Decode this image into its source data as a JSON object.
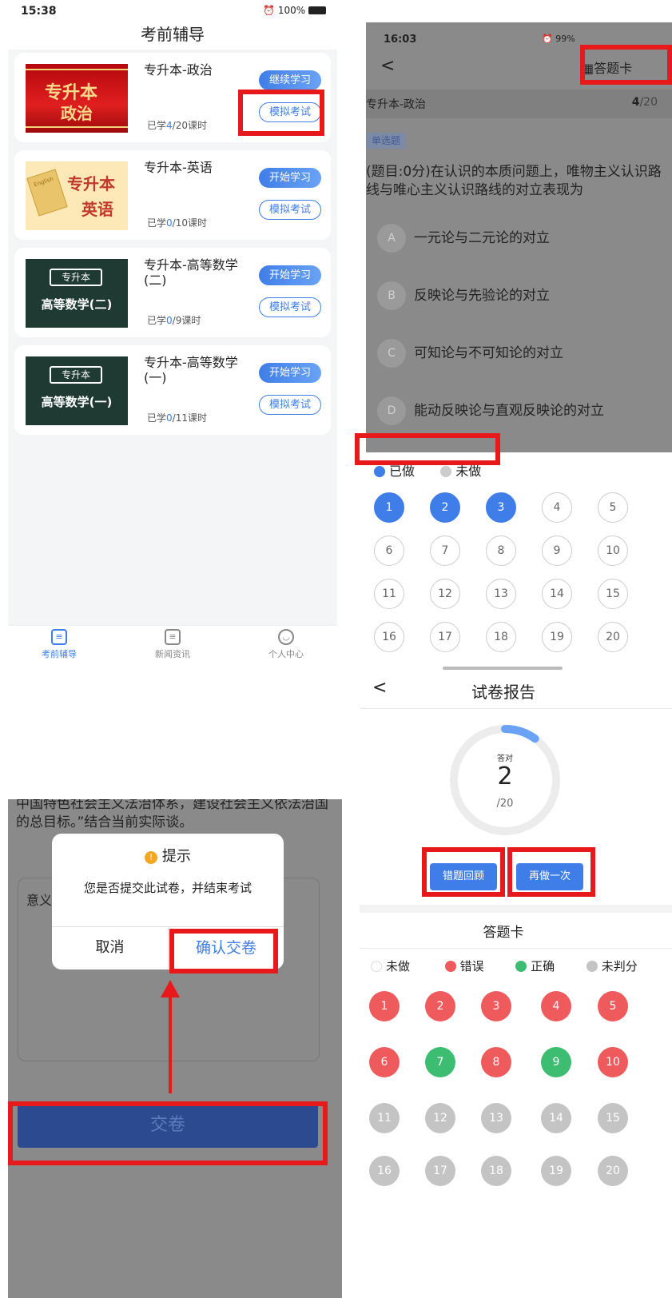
{
  "panel1": {
    "status_time": "15:38",
    "status_right": "100%",
    "header_title": "考前辅导",
    "courses": [
      {
        "thumb_line1": "专升本",
        "thumb_line2": "政治",
        "title": "专升本-政治",
        "prog_pre": "已学",
        "prog_num": "4",
        "prog_post": "/20课时",
        "study_label": "继续学习",
        "mock_label": "模拟考试"
      },
      {
        "thumb_line1": "专升本",
        "thumb_line2": "英语",
        "thumb_tag": "English",
        "title": "专升本-英语",
        "prog_pre": "已学",
        "prog_num": "0",
        "prog_post": "/10课时",
        "study_label": "开始学习",
        "mock_label": "模拟考试"
      },
      {
        "thumb_line1": "专升本",
        "thumb_line2": "高等数学(二)",
        "title": "专升本-高等数学(二)",
        "prog_pre": "已学",
        "prog_num": "0",
        "prog_post": "/9课时",
        "study_label": "开始学习",
        "mock_label": "模拟考试"
      },
      {
        "thumb_line1": "专升本",
        "thumb_line2": "高等数学(一)",
        "title": "专升本-高等数学(一)",
        "prog_pre": "已学",
        "prog_num": "0",
        "prog_post": "/11课时",
        "study_label": "开始学习",
        "mock_label": "模拟考试"
      }
    ],
    "tabs": [
      "考前辅导",
      "新闻资讯",
      "个人中心"
    ]
  },
  "panel2": {
    "status_time": "16:03",
    "status_right": "99%",
    "answer_card_label": "答题卡",
    "subject": "专升本-政治",
    "page_current": "4",
    "page_total": "/20",
    "qtype": "单选题",
    "question": "(题目:0分)在认识的本质问题上，唯物主义认识路线与唯心主义认识路线的对立表现为",
    "options": [
      {
        "letter": "A",
        "text": "一元论与二元论的对立"
      },
      {
        "letter": "B",
        "text": "反映论与先验论的对立"
      },
      {
        "letter": "C",
        "text": "可知论与不可知论的对立"
      },
      {
        "letter": "D",
        "text": "能动反映论与直观反映论的对立"
      }
    ],
    "legend_done": "已做",
    "legend_undone": "未做",
    "numbers": [
      "1",
      "2",
      "3",
      "4",
      "5",
      "6",
      "7",
      "8",
      "9",
      "10",
      "11",
      "12",
      "13",
      "14",
      "15",
      "16",
      "17",
      "18",
      "19",
      "20"
    ],
    "done_count": 3
  },
  "panel3": {
    "essay_text": "全会对全面推进依法治国做出战略部署，提出了建设中国特色社会主义法治体系，建设社会主义依法治国的总目标。”结合当前实际谈",
    "essay_tail": "。",
    "answer_prefix": "意义",
    "dialog_title": "提示",
    "dialog_message": "您是否提交此试卷，并结束考试",
    "cancel_label": "取消",
    "confirm_label": "确认交卷",
    "submit_label": "交卷"
  },
  "panel4": {
    "title": "试卷报告",
    "correct_label": "答对",
    "correct_value": "2",
    "total_label": "/20",
    "score_fraction": 0.1,
    "review_wrong_label": "错题回顾",
    "redo_label": "再做一次",
    "answer_card_title": "答题卡",
    "legend": [
      "未做",
      "错误",
      "正确",
      "未判分"
    ],
    "results": [
      "wrong",
      "wrong",
      "wrong",
      "wrong",
      "wrong",
      "wrong",
      "right",
      "wrong",
      "right",
      "wrong",
      "ungraded",
      "ungraded",
      "ungraded",
      "ungraded",
      "ungraded",
      "ungraded",
      "ungraded",
      "ungraded",
      "ungraded",
      "ungraded"
    ],
    "numbers": [
      "1",
      "2",
      "3",
      "4",
      "5",
      "6",
      "7",
      "8",
      "9",
      "10",
      "11",
      "12",
      "13",
      "14",
      "15",
      "16",
      "17",
      "18",
      "19",
      "20"
    ]
  },
  "colors": {
    "accent": "#3f7ee8",
    "highlight": "#e8191b",
    "wrong": "#ef5a5d",
    "right": "#3dbd72",
    "ungraded": "#c4c4c4"
  }
}
